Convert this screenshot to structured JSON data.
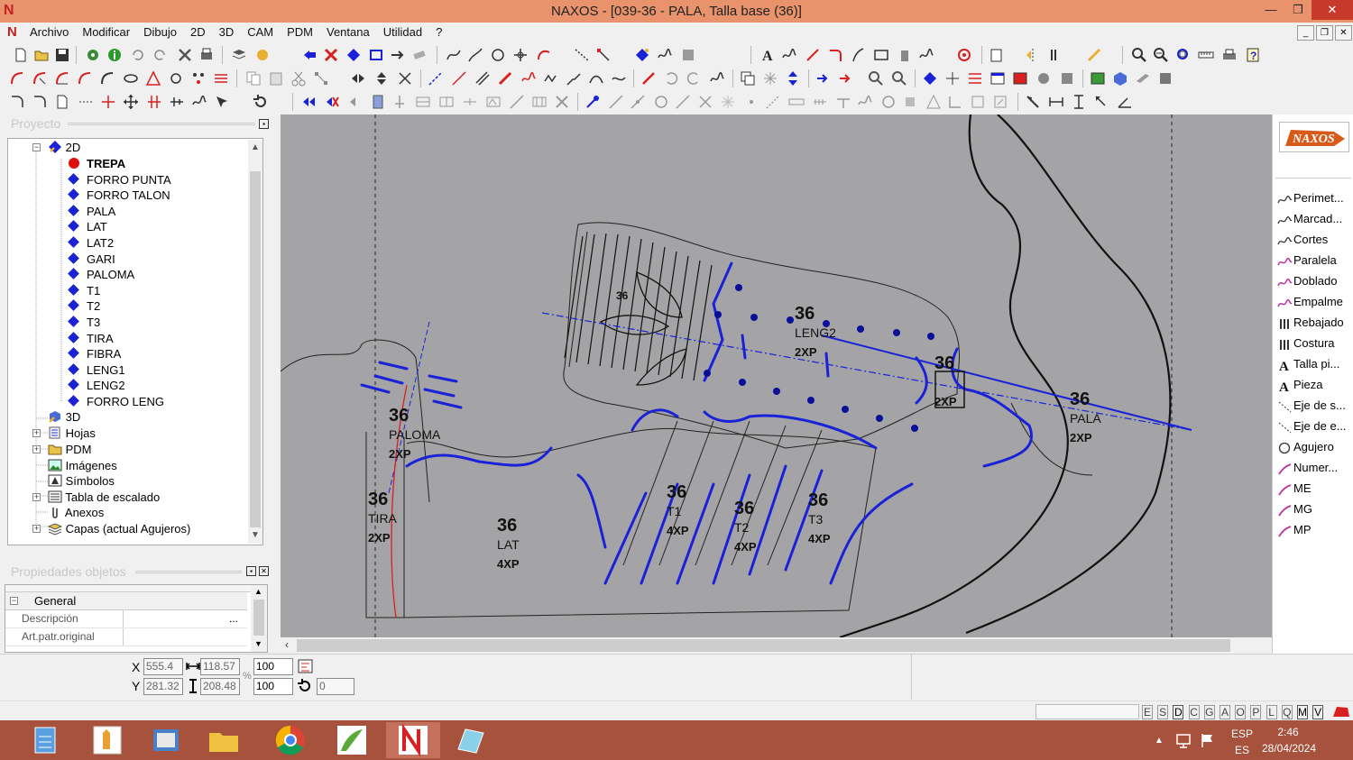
{
  "window": {
    "title": "NAXOS - [039-36 - PALA, Talla base (36)]"
  },
  "menu": [
    "Archivo",
    "Modificar",
    "Dibujo",
    "2D",
    "3D",
    "CAM",
    "PDM",
    "Ventana",
    "Utilidad",
    "?"
  ],
  "project_panel": {
    "title": "Proyecto",
    "root": "2D",
    "pieces": [
      "TREPA",
      "FORRO PUNTA",
      "FORRO TALON",
      "PALA",
      "LAT",
      "LAT2",
      "GARI",
      "PALOMA",
      "T1",
      "T2",
      "T3",
      "TIRA",
      "FIBRA",
      "LENG1",
      "LENG2",
      "FORRO LENG"
    ],
    "active_piece": "TREPA",
    "other_nodes": [
      "3D",
      "Hojas",
      "PDM",
      "Imágenes",
      "Símbolos",
      "Tabla de escalado",
      "Anexos",
      "Capas (actual Agujeros)"
    ]
  },
  "properties_panel": {
    "title": "Propiedades objetos",
    "section": "General",
    "rows": [
      {
        "label": "Descripción",
        "value": "",
        "button": "..."
      },
      {
        "label": "Art.patr.original",
        "value": ""
      }
    ]
  },
  "canvas": {
    "pieces": [
      {
        "size": "36",
        "name": "PALOMA",
        "qty": "2XP"
      },
      {
        "size": "36",
        "name": "TIRA",
        "qty": "2XP"
      },
      {
        "size": "36",
        "name": "LAT",
        "qty": "4XP"
      },
      {
        "size": "36",
        "name": "T1",
        "qty": "4XP"
      },
      {
        "size": "36",
        "name": "T2",
        "qty": "4XP"
      },
      {
        "size": "36",
        "name": "T3",
        "qty": "4XP"
      },
      {
        "size": "36",
        "name": "LENG2",
        "qty": "2XP"
      },
      {
        "size": "36",
        "name": "",
        "qty": "2XP"
      },
      {
        "size": "36",
        "name": "PALA",
        "qty": "2XP"
      }
    ],
    "small_label": "36"
  },
  "right_panel": {
    "logo": "NAXOS",
    "tools": [
      "Perimet...",
      "Marcad...",
      "Cortes",
      "Paralela",
      "Doblado",
      "Empalme",
      "Rebajado",
      "Costura",
      "Talla pi...",
      "Pieza",
      "Eje de s...",
      "Eje de e...",
      "Agujero",
      "Numer...",
      "ME",
      "MG",
      "MP"
    ]
  },
  "coords": {
    "x": "555.4",
    "y": "281.32",
    "w": "118.57",
    "h": "208.48",
    "scale_x": "100",
    "scale_y": "100",
    "rotation": "0",
    "x_label": "X",
    "y_label": "Y",
    "pct": "%"
  },
  "status_flags": [
    "E",
    "S",
    "D",
    "C",
    "G",
    "A",
    "O",
    "P",
    "L",
    "Q",
    "M",
    "V"
  ],
  "tray": {
    "lang1": "ESP",
    "lang2": "ES",
    "time": "2:46",
    "date": "28/04/2024"
  },
  "colors": {
    "titlebar": "#e8936b",
    "canvas": "#a4a4a6",
    "pattern_blue": "#1a22d8",
    "taskbar": "#a6523c"
  }
}
